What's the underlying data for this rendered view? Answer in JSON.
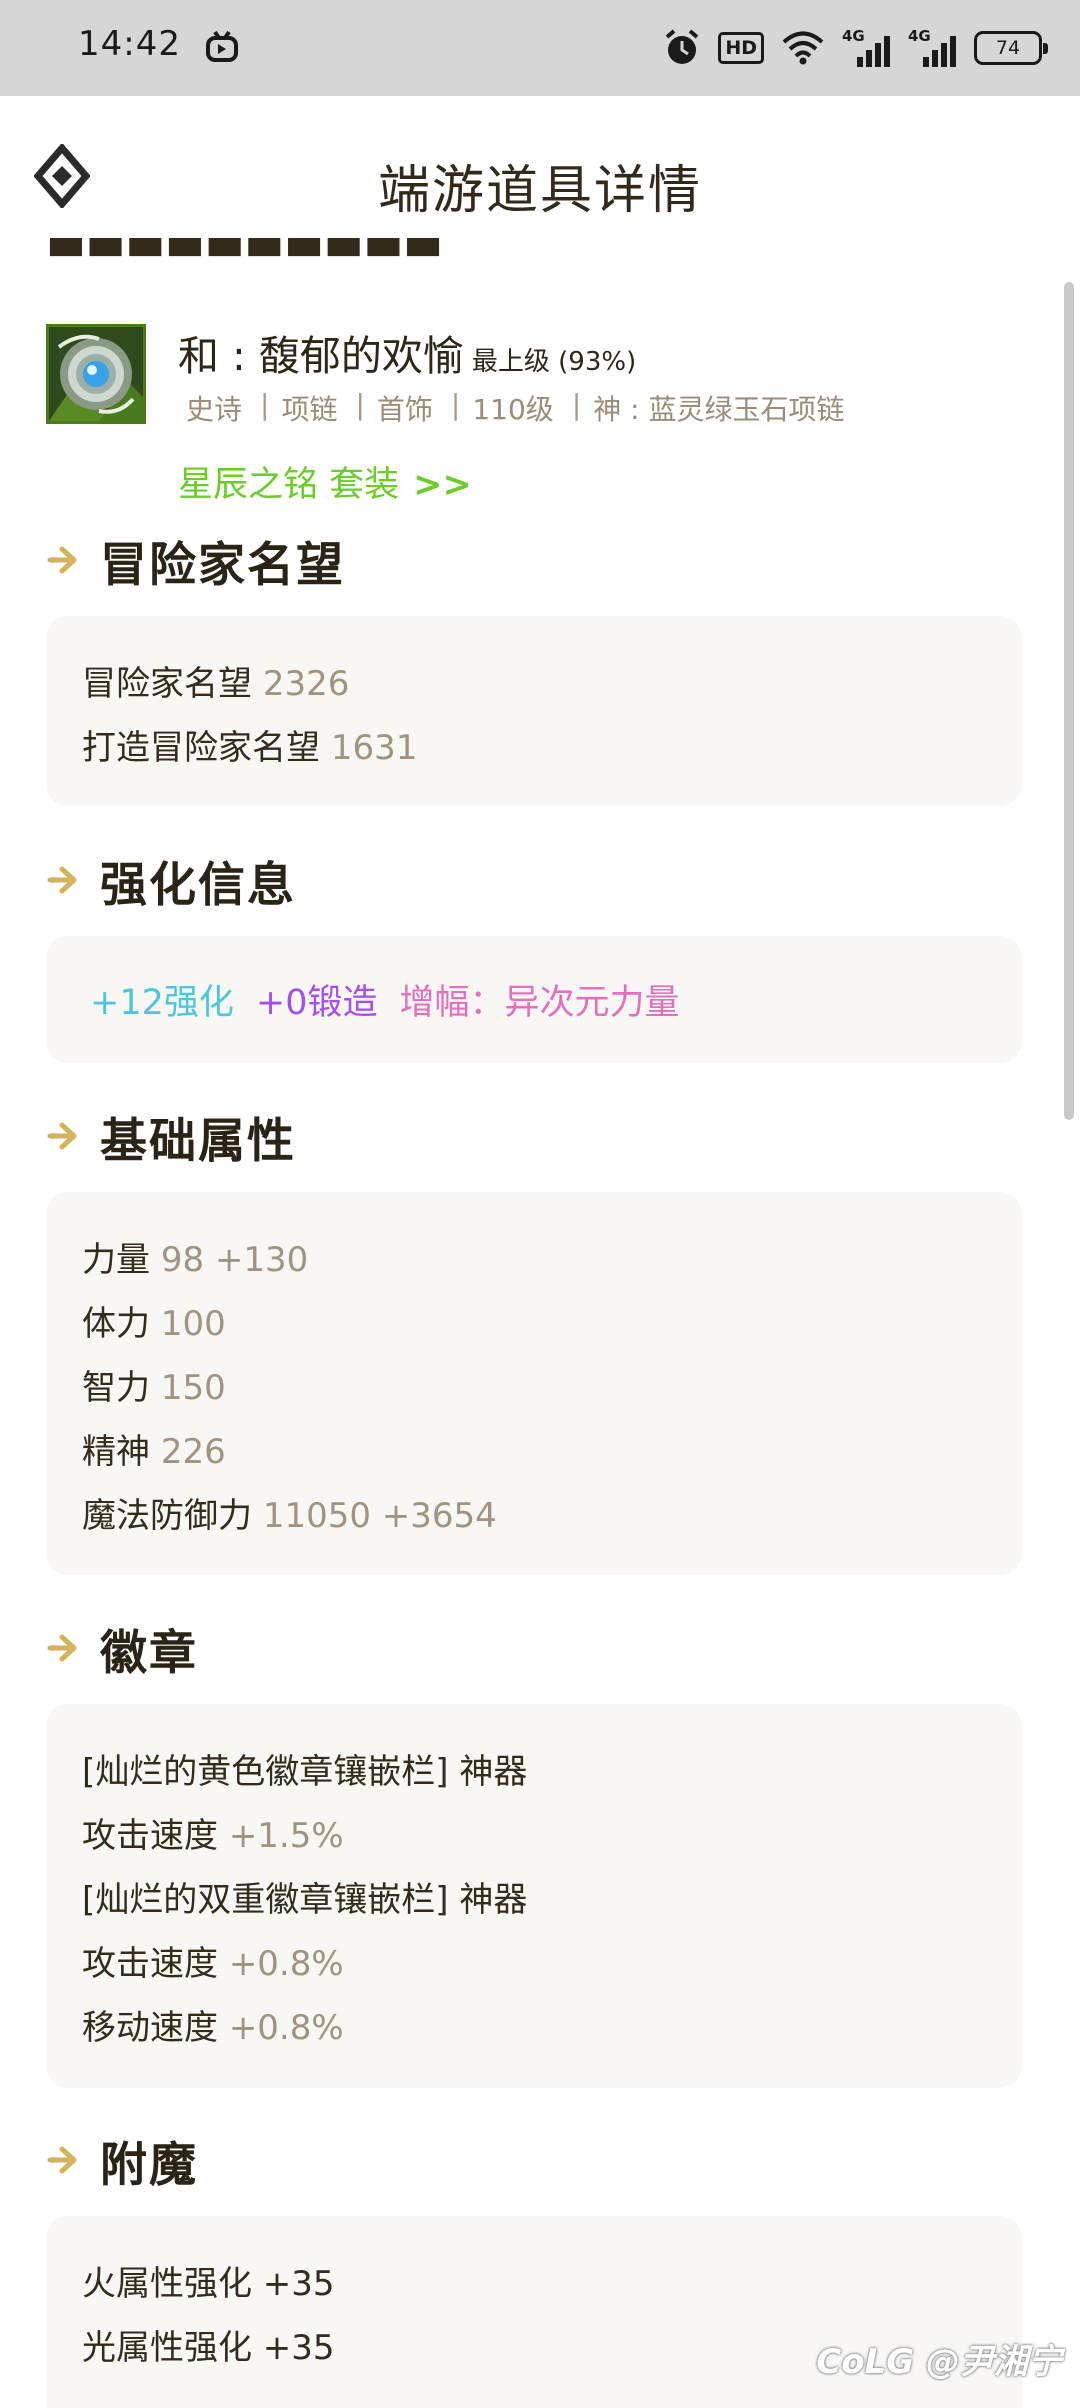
{
  "status_bar": {
    "time": "14:42",
    "hd_label": "HD",
    "net1_label": "4G",
    "net2_label": "4G",
    "battery": "74",
    "icons": [
      "app-notification-icon",
      "alarm-icon",
      "hd-icon",
      "wifi-icon",
      "signal-4g-icon",
      "signal-4g-icon",
      "battery-icon"
    ]
  },
  "header": {
    "title": "端游道具详情",
    "back_icon": "diamond-back-icon"
  },
  "item": {
    "name": "和 : 馥郁的欢愉",
    "level": "最上级 (93%)",
    "tags": [
      "史诗",
      "项链",
      "首饰",
      "110级",
      "神 : 蓝灵绿玉石项链"
    ],
    "tag_separator": "|",
    "set_label": "星辰之铭 套装",
    "set_arrow": ">>",
    "icon": "jewel-necklace-icon"
  },
  "sections": {
    "fame": {
      "title": "冒险家名望",
      "rows": [
        {
          "label": "冒险家名望",
          "value": "2326"
        },
        {
          "label": "打造冒险家名望",
          "value": "1631"
        }
      ]
    },
    "enhance": {
      "title": "强化信息",
      "refine": "+12强化",
      "forge": "+0锻造",
      "amplify": "增幅：异次元力量"
    },
    "base_attr": {
      "title": "基础属性",
      "rows": [
        {
          "label": "力量",
          "value": "98 +130"
        },
        {
          "label": "体力",
          "value": "100"
        },
        {
          "label": "智力",
          "value": "150"
        },
        {
          "label": "精神",
          "value": "226"
        },
        {
          "label": "魔法防御力",
          "value": "11050 +3654"
        }
      ]
    },
    "emblem": {
      "title": "徽章",
      "rows": [
        {
          "label": "[灿烂的黄色徽章镶嵌栏] 神器",
          "value": ""
        },
        {
          "label": "攻击速度",
          "value": "+1.5%"
        },
        {
          "label": "[灿烂的双重徽章镶嵌栏] 神器",
          "value": ""
        },
        {
          "label": "攻击速度",
          "value": "+0.8%"
        },
        {
          "label": "移动速度",
          "value": "+0.8%"
        }
      ]
    },
    "enchant": {
      "title": "附魔",
      "rows": [
        {
          "label": "火属性强化 +35",
          "value": ""
        },
        {
          "label": "光属性强化 +35",
          "value": ""
        }
      ]
    }
  },
  "watermark": "CoLG @尹湘宁",
  "colors": {
    "accent_green": "#6ccd2a",
    "refine_cyan": "#4cc6dc",
    "forge_purple": "#a64ff0",
    "amplify_pink": "#e46fc0",
    "value_gray": "#a09381",
    "card_bg": "#f8f7f4",
    "section_arrow": "#d8b25a"
  }
}
